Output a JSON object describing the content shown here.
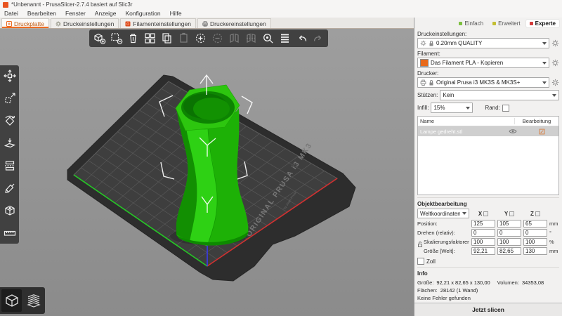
{
  "window": {
    "title": "*Unbenannt - PrusaSlicer-2.7.4 basiert auf Slic3r"
  },
  "menu": {
    "items": [
      "Datei",
      "Bearbeiten",
      "Fenster",
      "Anzeige",
      "Konfiguration",
      "Hilfe"
    ]
  },
  "tabs": [
    {
      "label": "Druckplatte",
      "icon": "plate-icon",
      "active": true
    },
    {
      "label": "Druckeinstellungen",
      "icon": "gear-icon",
      "active": false
    },
    {
      "label": "Filamenteinstellungen",
      "icon": "filament-icon",
      "active": false
    },
    {
      "label": "Druckereinstellungen",
      "icon": "printer-icon",
      "active": false
    }
  ],
  "modes": {
    "simple": {
      "label": "Einfach",
      "color": "#7cbf3f"
    },
    "advanced": {
      "label": "Erweitert",
      "color": "#c3be32"
    },
    "expert": {
      "label": "Experte",
      "color": "#d33a3a",
      "active": true
    }
  },
  "toolbar_top": {
    "items": [
      "add-object",
      "delete-object",
      "delete-all",
      "arrange",
      "copy",
      "paste",
      "add-instance",
      "remove-instance",
      "split-to-objects",
      "split-to-parts",
      "search",
      "variable-layer-height",
      "undo",
      "redo"
    ]
  },
  "toolbar_left": {
    "items": [
      "move",
      "scale",
      "rotate",
      "place-on-face",
      "cut",
      "paint-supports",
      "seam",
      "measure"
    ]
  },
  "view_toggle": {
    "items": [
      "3d-editor-view",
      "preview-view"
    ]
  },
  "viewport": {
    "bed_brand": "ORIGINAL PRUSA i3 MK3",
    "bed_byline": "by Josef Prusa",
    "object_color": "#2dc60f"
  },
  "sidebar": {
    "print_settings": {
      "label": "Druckeinstellungen:",
      "value": "0.20mm QUALITY"
    },
    "filament": {
      "label": "Filament:",
      "value": "Das Filament PLA - Kopieren",
      "swatch_color": "#e8691a"
    },
    "printer": {
      "label": "Drucker:",
      "value": "Original Prusa i3 MK3S & MK3S+"
    },
    "supports": {
      "label": "Stützen:",
      "value": "Kein"
    },
    "infill": {
      "label": "Infill:",
      "value": "15%"
    },
    "brim": {
      "label": "Rand:",
      "checked": false
    },
    "object_table": {
      "columns": [
        "Name",
        "Bearbeitung"
      ],
      "rows": [
        {
          "name": "Lampe gedreht.stl",
          "selected": true
        }
      ]
    },
    "manipulation": {
      "title": "Objektbearbeitung",
      "coordinates": "Weltkoordinaten",
      "axis_headers": [
        "X",
        "Y",
        "Z"
      ],
      "rows": [
        {
          "label": "Position:",
          "x": "125",
          "y": "105",
          "z": "65",
          "unit": "mm"
        },
        {
          "label": "Drehen (relativ):",
          "x": "0",
          "y": "0",
          "z": "0",
          "unit": "°"
        },
        {
          "label": "Skalierungsfaktoren:",
          "x": "100",
          "y": "100",
          "z": "100",
          "unit": "%"
        },
        {
          "label": "Größe [Welt]:",
          "x": "92,21",
          "y": "82,65",
          "z": "130",
          "unit": "mm"
        }
      ],
      "inches_label": "Zoll"
    },
    "info": {
      "title": "Info",
      "size_label": "Größe:",
      "size": "92,21 x 82,65 x 130,00",
      "volume_label": "Volumen:",
      "volume": "34353,08",
      "facets_label": "Flächen:",
      "facets": "28142 (1 Wand)",
      "status": "Keine Fehler gefunden"
    },
    "slice_button": "Jetzt slicen"
  },
  "colors": {
    "accent": "#ed6b21",
    "mode_simple": "#7cbf3f",
    "mode_advanced": "#c3be32",
    "mode_expert": "#d33a3a"
  }
}
